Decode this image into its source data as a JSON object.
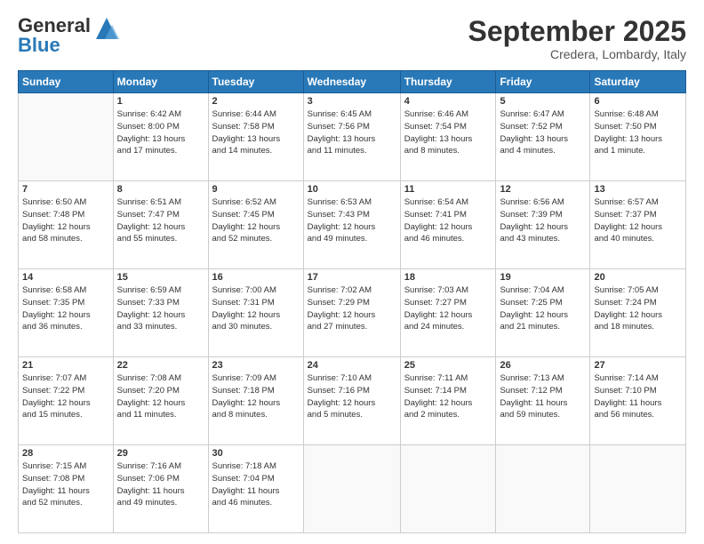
{
  "header": {
    "logo_general": "General",
    "logo_blue": "Blue",
    "month": "September 2025",
    "location": "Credera, Lombardy, Italy"
  },
  "weekdays": [
    "Sunday",
    "Monday",
    "Tuesday",
    "Wednesday",
    "Thursday",
    "Friday",
    "Saturday"
  ],
  "weeks": [
    [
      {
        "day": "",
        "info": ""
      },
      {
        "day": "1",
        "info": "Sunrise: 6:42 AM\nSunset: 8:00 PM\nDaylight: 13 hours\nand 17 minutes."
      },
      {
        "day": "2",
        "info": "Sunrise: 6:44 AM\nSunset: 7:58 PM\nDaylight: 13 hours\nand 14 minutes."
      },
      {
        "day": "3",
        "info": "Sunrise: 6:45 AM\nSunset: 7:56 PM\nDaylight: 13 hours\nand 11 minutes."
      },
      {
        "day": "4",
        "info": "Sunrise: 6:46 AM\nSunset: 7:54 PM\nDaylight: 13 hours\nand 8 minutes."
      },
      {
        "day": "5",
        "info": "Sunrise: 6:47 AM\nSunset: 7:52 PM\nDaylight: 13 hours\nand 4 minutes."
      },
      {
        "day": "6",
        "info": "Sunrise: 6:48 AM\nSunset: 7:50 PM\nDaylight: 13 hours\nand 1 minute."
      }
    ],
    [
      {
        "day": "7",
        "info": "Sunrise: 6:50 AM\nSunset: 7:48 PM\nDaylight: 12 hours\nand 58 minutes."
      },
      {
        "day": "8",
        "info": "Sunrise: 6:51 AM\nSunset: 7:47 PM\nDaylight: 12 hours\nand 55 minutes."
      },
      {
        "day": "9",
        "info": "Sunrise: 6:52 AM\nSunset: 7:45 PM\nDaylight: 12 hours\nand 52 minutes."
      },
      {
        "day": "10",
        "info": "Sunrise: 6:53 AM\nSunset: 7:43 PM\nDaylight: 12 hours\nand 49 minutes."
      },
      {
        "day": "11",
        "info": "Sunrise: 6:54 AM\nSunset: 7:41 PM\nDaylight: 12 hours\nand 46 minutes."
      },
      {
        "day": "12",
        "info": "Sunrise: 6:56 AM\nSunset: 7:39 PM\nDaylight: 12 hours\nand 43 minutes."
      },
      {
        "day": "13",
        "info": "Sunrise: 6:57 AM\nSunset: 7:37 PM\nDaylight: 12 hours\nand 40 minutes."
      }
    ],
    [
      {
        "day": "14",
        "info": "Sunrise: 6:58 AM\nSunset: 7:35 PM\nDaylight: 12 hours\nand 36 minutes."
      },
      {
        "day": "15",
        "info": "Sunrise: 6:59 AM\nSunset: 7:33 PM\nDaylight: 12 hours\nand 33 minutes."
      },
      {
        "day": "16",
        "info": "Sunrise: 7:00 AM\nSunset: 7:31 PM\nDaylight: 12 hours\nand 30 minutes."
      },
      {
        "day": "17",
        "info": "Sunrise: 7:02 AM\nSunset: 7:29 PM\nDaylight: 12 hours\nand 27 minutes."
      },
      {
        "day": "18",
        "info": "Sunrise: 7:03 AM\nSunset: 7:27 PM\nDaylight: 12 hours\nand 24 minutes."
      },
      {
        "day": "19",
        "info": "Sunrise: 7:04 AM\nSunset: 7:25 PM\nDaylight: 12 hours\nand 21 minutes."
      },
      {
        "day": "20",
        "info": "Sunrise: 7:05 AM\nSunset: 7:24 PM\nDaylight: 12 hours\nand 18 minutes."
      }
    ],
    [
      {
        "day": "21",
        "info": "Sunrise: 7:07 AM\nSunset: 7:22 PM\nDaylight: 12 hours\nand 15 minutes."
      },
      {
        "day": "22",
        "info": "Sunrise: 7:08 AM\nSunset: 7:20 PM\nDaylight: 12 hours\nand 11 minutes."
      },
      {
        "day": "23",
        "info": "Sunrise: 7:09 AM\nSunset: 7:18 PM\nDaylight: 12 hours\nand 8 minutes."
      },
      {
        "day": "24",
        "info": "Sunrise: 7:10 AM\nSunset: 7:16 PM\nDaylight: 12 hours\nand 5 minutes."
      },
      {
        "day": "25",
        "info": "Sunrise: 7:11 AM\nSunset: 7:14 PM\nDaylight: 12 hours\nand 2 minutes."
      },
      {
        "day": "26",
        "info": "Sunrise: 7:13 AM\nSunset: 7:12 PM\nDaylight: 11 hours\nand 59 minutes."
      },
      {
        "day": "27",
        "info": "Sunrise: 7:14 AM\nSunset: 7:10 PM\nDaylight: 11 hours\nand 56 minutes."
      }
    ],
    [
      {
        "day": "28",
        "info": "Sunrise: 7:15 AM\nSunset: 7:08 PM\nDaylight: 11 hours\nand 52 minutes."
      },
      {
        "day": "29",
        "info": "Sunrise: 7:16 AM\nSunset: 7:06 PM\nDaylight: 11 hours\nand 49 minutes."
      },
      {
        "day": "30",
        "info": "Sunrise: 7:18 AM\nSunset: 7:04 PM\nDaylight: 11 hours\nand 46 minutes."
      },
      {
        "day": "",
        "info": ""
      },
      {
        "day": "",
        "info": ""
      },
      {
        "day": "",
        "info": ""
      },
      {
        "day": "",
        "info": ""
      }
    ]
  ]
}
